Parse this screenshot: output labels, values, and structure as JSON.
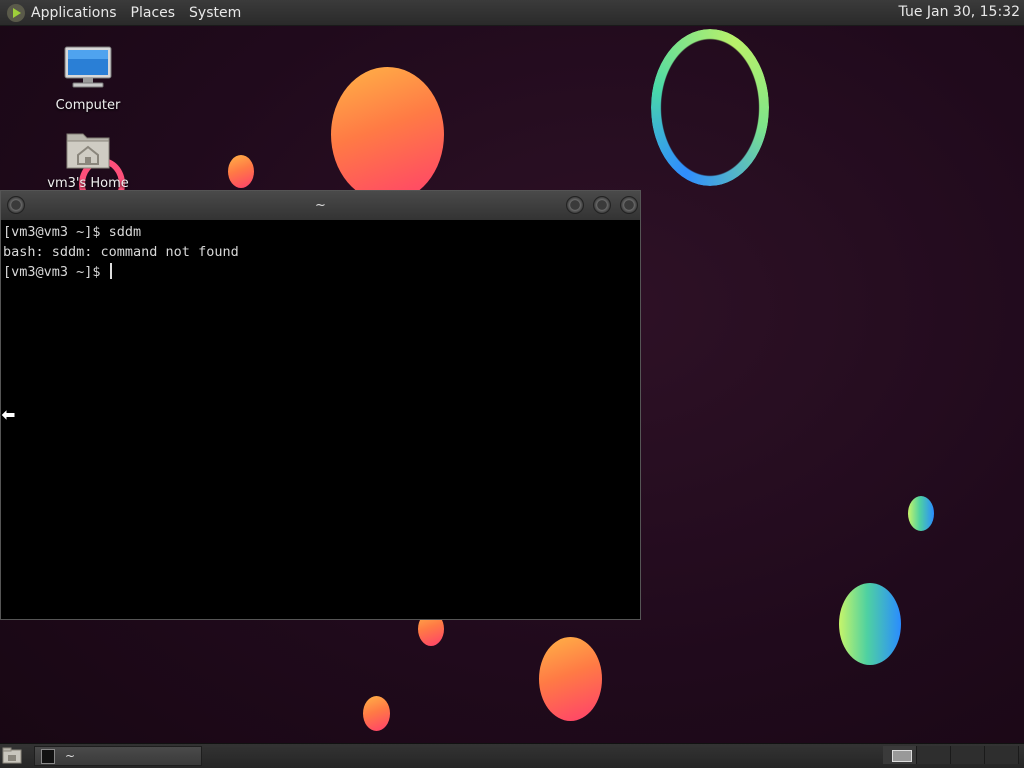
{
  "top_panel": {
    "menus": [
      "Applications",
      "Places",
      "System"
    ],
    "clock": "Tue Jan 30, 15:32"
  },
  "desktop_icons": [
    {
      "label": "Computer",
      "icon": "computer-icon"
    },
    {
      "label": "vm3's Home",
      "icon": "home-folder-icon"
    }
  ],
  "terminal": {
    "title": "~",
    "lines": [
      "[vm3@vm3 ~]$ sddm",
      "bash: sddm: command not found",
      "[vm3@vm3 ~]$ "
    ]
  },
  "taskbar": {
    "window_label": "~",
    "workspaces": 4
  },
  "colors": {
    "desktop_bg": "#200a1c",
    "panel_bg": "#2a2a2a",
    "terminal_bg": "#000000"
  }
}
